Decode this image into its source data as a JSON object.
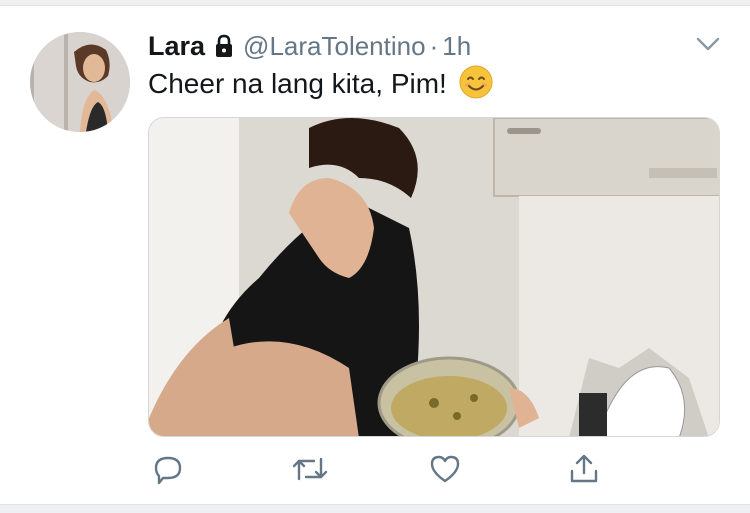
{
  "tweet": {
    "author_name": "Lara",
    "handle": "@LaraTolentino",
    "separator": "·",
    "time": "1h",
    "text": "Cheer na lang kita, Pim!",
    "emoji": "smiling-face-icon",
    "protected_account": true
  },
  "icons": {
    "lock": "lock-icon",
    "menu": "chevron-down-icon",
    "reply": "reply-icon",
    "retweet": "retweet-icon",
    "like": "heart-icon",
    "share": "share-icon"
  },
  "colors": {
    "text_primary": "#14171a",
    "text_secondary": "#657786",
    "icon_gray": "#657786",
    "emoji_yellow": "#f7c33b"
  }
}
